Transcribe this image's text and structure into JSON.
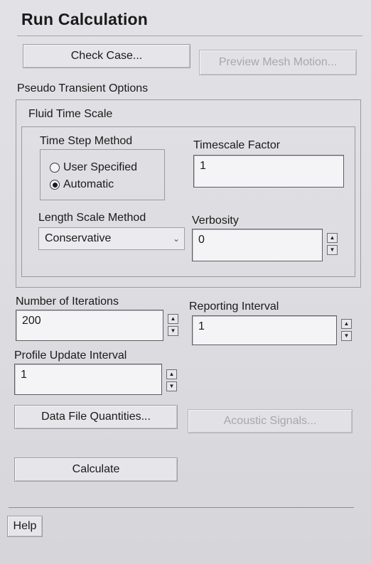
{
  "panel": {
    "title": "Run Calculation"
  },
  "buttons": {
    "check_case": "Check Case...",
    "preview_mesh_motion": "Preview Mesh Motion...",
    "data_file_quantities": "Data File Quantities...",
    "acoustic_signals": "Acoustic Signals...",
    "calculate": "Calculate",
    "help": "Help"
  },
  "pseudo_transient": {
    "group_label": "Pseudo Transient Options",
    "fluid_time_scale": {
      "group_label": "Fluid Time Scale",
      "time_step_method": {
        "label": "Time Step Method",
        "options": [
          {
            "label": "User Specified",
            "selected": false
          },
          {
            "label": "Automatic",
            "selected": true
          }
        ]
      },
      "timescale_factor": {
        "label": "Timescale Factor",
        "value": "1"
      },
      "length_scale_method": {
        "label": "Length Scale Method",
        "value": "Conservative"
      },
      "verbosity": {
        "label": "Verbosity",
        "value": "0"
      }
    }
  },
  "iterations": {
    "number_of_iterations": {
      "label": "Number of Iterations",
      "value": "200"
    },
    "reporting_interval": {
      "label": "Reporting Interval",
      "value": "1"
    },
    "profile_update_interval": {
      "label": "Profile Update Interval",
      "value": "1"
    }
  },
  "icons": {
    "spin_up": "up-triangle",
    "spin_down": "down-triangle",
    "dropdown": "chevron-down"
  }
}
